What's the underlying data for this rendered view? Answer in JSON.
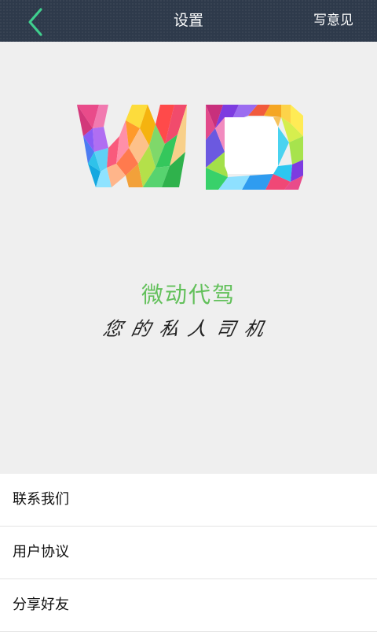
{
  "header": {
    "title": "设置",
    "feedback_label": "写意见",
    "back_icon": "chevron-left-icon",
    "accent_color": "#3fcf8e",
    "background_color": "#2e3a4b"
  },
  "hero": {
    "logo_text": "WD",
    "app_name": "微动代驾",
    "slogan": "您的私人司机",
    "app_name_color": "#62c05a"
  },
  "menu": {
    "items": [
      {
        "label": "联系我们"
      },
      {
        "label": "用户协议"
      },
      {
        "label": "分享好友"
      }
    ]
  }
}
